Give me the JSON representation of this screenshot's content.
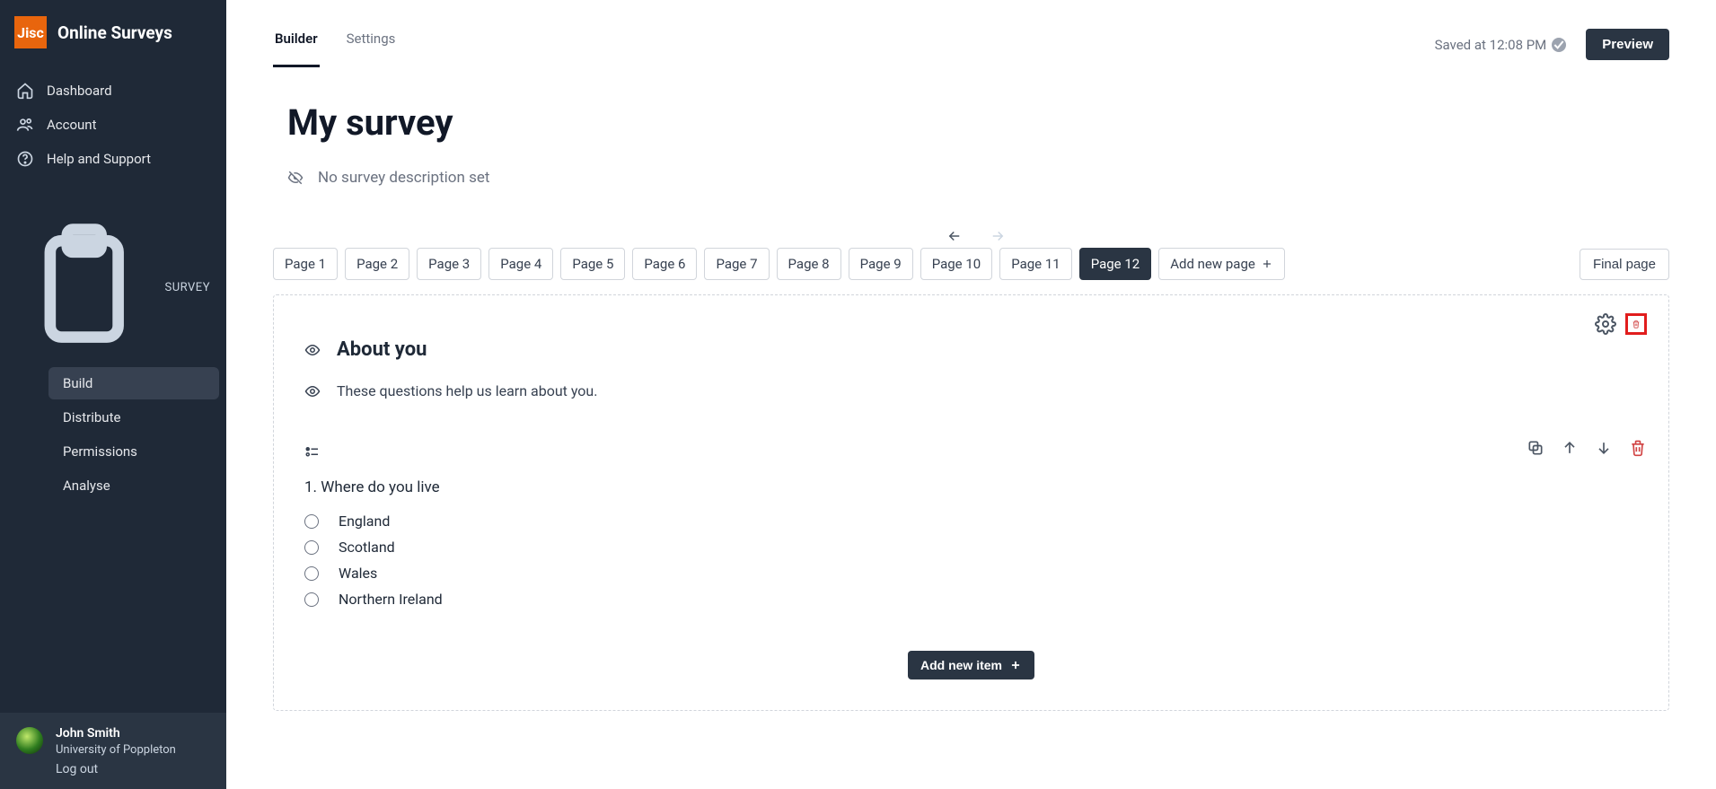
{
  "brand": {
    "short": "Jisc",
    "name": "Online Surveys"
  },
  "sidebar": {
    "items": [
      {
        "label": "Dashboard"
      },
      {
        "label": "Account"
      },
      {
        "label": "Help and Support"
      }
    ],
    "survey_heading": "SURVEY",
    "survey_items": [
      {
        "label": "Build"
      },
      {
        "label": "Distribute"
      },
      {
        "label": "Permissions"
      },
      {
        "label": "Analyse"
      }
    ],
    "user": {
      "name": "John Smith",
      "institution": "University of Poppleton",
      "logout": "Log out"
    }
  },
  "tabs": {
    "builder": "Builder",
    "settings": "Settings"
  },
  "saved_text": "Saved at 12:08 PM",
  "preview_label": "Preview",
  "survey": {
    "title": "My survey",
    "description": "No survey description set"
  },
  "pages": {
    "list": [
      "Page 1",
      "Page 2",
      "Page 3",
      "Page 4",
      "Page 5",
      "Page 6",
      "Page 7",
      "Page 8",
      "Page 9",
      "Page 10",
      "Page 11",
      "Page 12"
    ],
    "active_index": 11,
    "add_label": "Add new page",
    "final_label": "Final page"
  },
  "page": {
    "section_title": "About you",
    "section_desc": "These questions help us learn about you.",
    "question": {
      "text": "1. Where do you live",
      "options": [
        "England",
        "Scotland",
        "Wales",
        "Northern Ireland"
      ]
    },
    "add_item_label": "Add new item"
  }
}
